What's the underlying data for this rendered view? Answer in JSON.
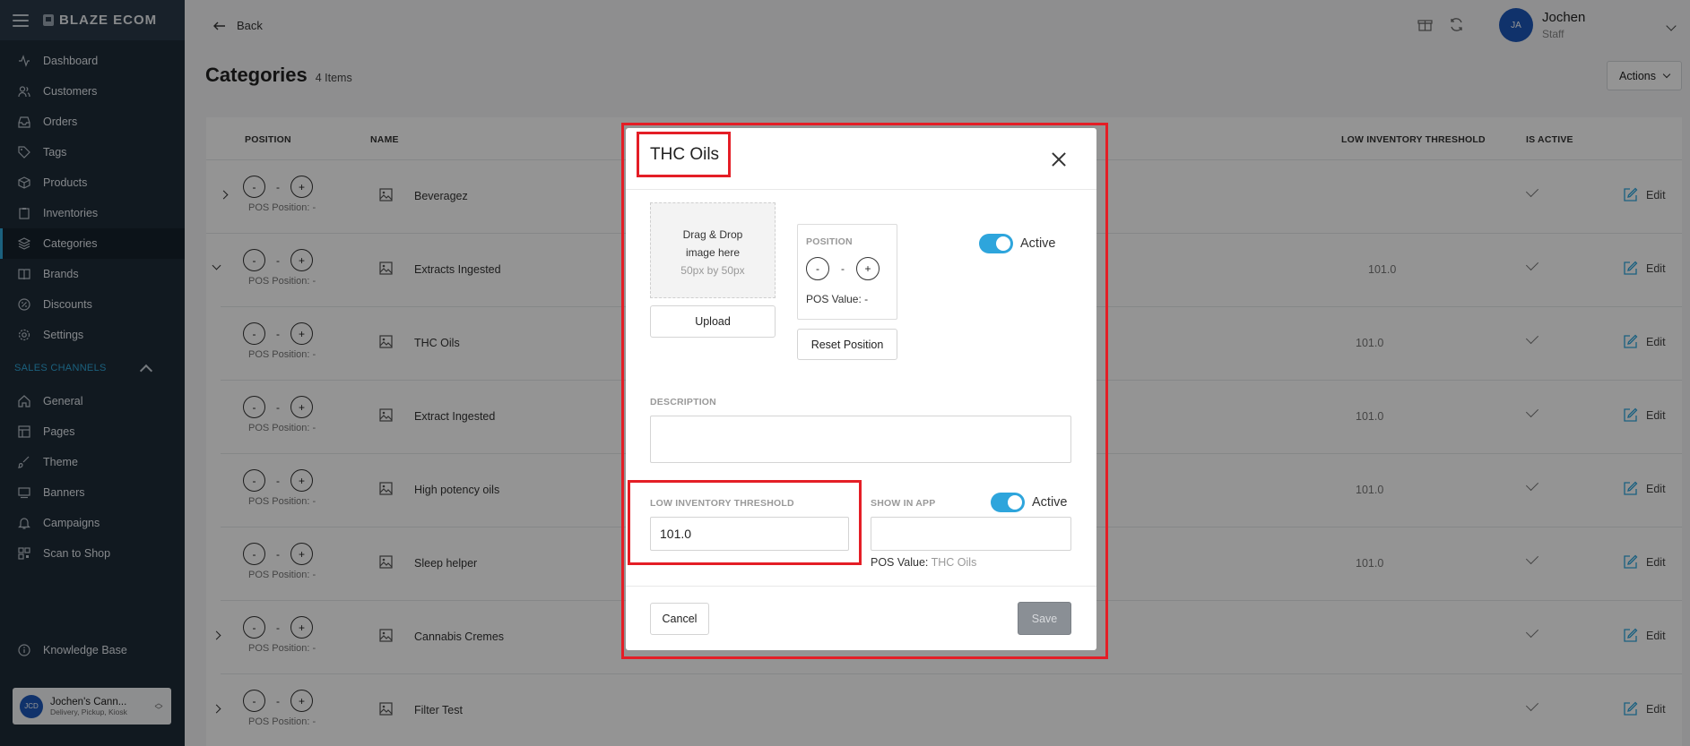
{
  "sidebar": {
    "brand": "BLAZE ECOM",
    "items": [
      {
        "label": "Dashboard",
        "icon": "activity-icon"
      },
      {
        "label": "Customers",
        "icon": "users-icon"
      },
      {
        "label": "Orders",
        "icon": "inbox-icon"
      },
      {
        "label": "Tags",
        "icon": "tag-icon"
      },
      {
        "label": "Products",
        "icon": "box-icon"
      },
      {
        "label": "Inventories",
        "icon": "clipboard-icon"
      },
      {
        "label": "Categories",
        "icon": "layers-icon"
      },
      {
        "label": "Brands",
        "icon": "book-icon"
      },
      {
        "label": "Discounts",
        "icon": "discount-icon"
      },
      {
        "label": "Settings",
        "icon": "gear-icon"
      }
    ],
    "section_label": "SALES CHANNELS",
    "channel_items": [
      {
        "label": "General",
        "icon": "home-icon"
      },
      {
        "label": "Pages",
        "icon": "layout-icon"
      },
      {
        "label": "Theme",
        "icon": "brush-icon"
      },
      {
        "label": "Banners",
        "icon": "banner-icon"
      },
      {
        "label": "Campaigns",
        "icon": "bell-icon"
      },
      {
        "label": "Scan to Shop",
        "icon": "qr-icon"
      }
    ],
    "knowledge_base": "Knowledge Base",
    "store": {
      "initials": "JCD",
      "name": "Jochen's Cann...",
      "sub": "Delivery, Pickup, Kiosk"
    }
  },
  "topbar": {
    "back_label": "Back",
    "user": {
      "initials": "JA",
      "name": "Jochen",
      "role": "Staff"
    }
  },
  "page": {
    "title": "Categories",
    "count": "4 Items",
    "actions_label": "Actions"
  },
  "table": {
    "headers": {
      "position": "POSITION",
      "name": "NAME",
      "threshold": "LOW INVENTORY THRESHOLD",
      "active": "IS ACTIVE"
    },
    "edit_label": "Edit",
    "rows": [
      {
        "name": "Beveragez",
        "pos_label": "POS Position: -",
        "threshold": "",
        "expander": "collapsed",
        "active": true
      },
      {
        "name": "Extracts Ingested",
        "pos_label": "POS Position: -",
        "threshold": "101.0",
        "expander": "expanded",
        "active": true
      },
      {
        "name": "THC Oils",
        "pos_label": "POS Position: -",
        "threshold": "101.0",
        "expander": "none",
        "active": true
      },
      {
        "name": "Extract Ingested",
        "pos_label": "POS Position: -",
        "threshold": "101.0",
        "expander": "none",
        "active": true
      },
      {
        "name": "High potency oils",
        "pos_label": "POS Position: -",
        "threshold": "101.0",
        "expander": "none",
        "active": true
      },
      {
        "name": "Sleep helper",
        "pos_label": "POS Position: -",
        "threshold": "101.0",
        "expander": "none",
        "active": true
      },
      {
        "name": "Cannabis Cremes",
        "pos_label": "POS Position: -",
        "threshold": "",
        "expander": "collapsed",
        "active": true
      },
      {
        "name": "Filter Test",
        "pos_label": "POS Position: -",
        "threshold": "",
        "expander": "collapsed",
        "active": true
      }
    ]
  },
  "modal": {
    "title": "THC Oils",
    "dropzone_line1": "Drag & Drop",
    "dropzone_line2": "image here",
    "dropzone_hint": "50px by 50px",
    "upload_label": "Upload",
    "position_label": "POSITION",
    "pos_value_label": "POS Value: -",
    "reset_label": "Reset Position",
    "active_label": "Active",
    "description_label": "DESCRIPTION",
    "description_value": "",
    "threshold_label": "LOW INVENTORY THRESHOLD",
    "threshold_value": "101.0",
    "show_in_app_label": "SHOW IN APP",
    "show_active_label": "Active",
    "pos_value2_label": "POS Value:",
    "pos_value2": "THC Oils",
    "cancel_label": "Cancel",
    "save_label": "Save"
  },
  "colors": {
    "accent": "#2ea5dc",
    "highlight": "#e41e26",
    "sidebar_bg": "#1e2b38"
  }
}
